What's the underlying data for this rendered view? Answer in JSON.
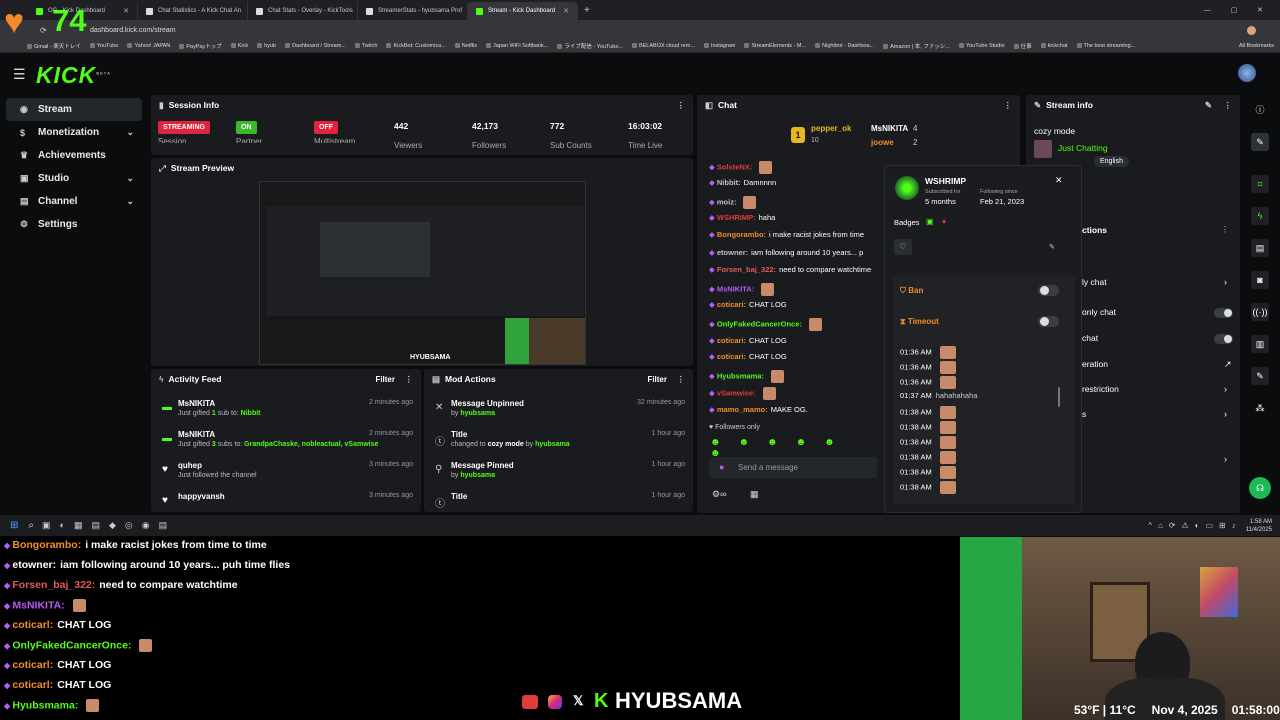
{
  "overlay": {
    "follower_count": "74"
  },
  "browser": {
    "tabs": [
      {
        "label": "OG - Kick Dashboard"
      },
      {
        "label": "Chat Statistics - A Kick Chat An"
      },
      {
        "label": "Chat Stats - Overlay - KickTools"
      },
      {
        "label": "StreamerStats - hyubsama Prof"
      },
      {
        "label": "Stream - Kick Dashboard"
      }
    ],
    "new_tab": "+",
    "url": "dashboard.kick.com/stream",
    "bookmarks": [
      "Gmail - 楽天トレイ",
      "YouTube",
      "Yahoo! JAPAN",
      "PayPayトップ",
      "Kick",
      "hyub",
      "Dashboard / Stream...",
      "Twitch",
      "KickBot: Customiza...",
      "Netflix",
      "Japan WiFi Softbank...",
      "ライブ配信 - YouTube...",
      "BELABOX cloud rem...",
      "Instagram",
      "StreamElements - M...",
      "Nightbot - Dashboa...",
      "Amazon | 本, ファッシ...",
      "YouTube Studio",
      "仕事",
      "kickchat",
      "The best streaming..."
    ],
    "all_bookmarks": "All Bookmarks"
  },
  "kick": {
    "logo": "KICK",
    "beta": "BETA"
  },
  "sidebar": {
    "items": [
      {
        "label": "Stream",
        "icon": "stream-icon"
      },
      {
        "label": "Monetization",
        "icon": "dollar-icon"
      },
      {
        "label": "Achievements",
        "icon": "trophy-icon"
      },
      {
        "label": "Studio",
        "icon": "studio-icon"
      },
      {
        "label": "Channel",
        "icon": "channel-icon"
      },
      {
        "label": "Settings",
        "icon": "gear-icon"
      }
    ]
  },
  "session": {
    "title": "Session Info",
    "streaming": "STREAMING",
    "session_label": "Session",
    "on": "ON",
    "partner_label": "Partner",
    "off": "OFF",
    "multistream_label": "Multistream",
    "viewers": "442",
    "viewers_label": "Viewers",
    "followers": "42,173",
    "followers_label": "Followers",
    "subs": "772",
    "subs_label": "Sub Counts",
    "time": "16:03:02",
    "time_label": "Time Live"
  },
  "preview": {
    "title": "Stream Preview",
    "watermark": "HYUBSAMA"
  },
  "activity": {
    "title": "Activity Feed",
    "filter": "Filter",
    "items": [
      {
        "user": "MsNIKITA",
        "pre": "Just gifted ",
        "count": "1",
        "mid": " sub to: ",
        "target": "Nibbit",
        "time": "2 minutes ago"
      },
      {
        "user": "MsNIKITA",
        "pre": "Just gifted ",
        "count": "3",
        "mid": " subs to: ",
        "target": "GrandpaChaske, nobleactual, vSamwise",
        "time": "2 minutes ago"
      },
      {
        "user": "quhep",
        "desc": "Just followed the channel",
        "time": "3 minutes ago"
      },
      {
        "user": "happyvansh",
        "desc": "",
        "time": "3 minutes ago"
      }
    ]
  },
  "mod": {
    "title": "Mod Actions",
    "filter": "Filter",
    "items": [
      {
        "title": "Message Unpinned",
        "desc": "by ",
        "user": "hyubsama",
        "time": "32 minutes ago"
      },
      {
        "title": "Title",
        "desc": "changed to ",
        "value": "cozy mode",
        "by": " by ",
        "user": "hyubsama",
        "time": "1 hour ago"
      },
      {
        "title": "Message Pinned",
        "desc": "by ",
        "user": "hyubsama",
        "time": "1 hour ago"
      },
      {
        "title": "Title",
        "desc": "",
        "time": "1 hour ago"
      }
    ]
  },
  "chat": {
    "title": "Chat",
    "leaders": [
      {
        "name": "pepper_ok",
        "value": "10"
      },
      {
        "name": "MsNIKITA",
        "value": "4"
      },
      {
        "name": "joowe",
        "value": "2"
      }
    ],
    "messages": [
      {
        "user": "SolsteNX:",
        "text": "",
        "color": "#e23b3b"
      },
      {
        "user": "Nibbit:",
        "text": "Damnnnn",
        "color": "#c0c0c0"
      },
      {
        "user": "moiz:",
        "text": "",
        "color": "#c0c0c0"
      },
      {
        "user": "WSHRIMP:",
        "text": "haha",
        "color": "#e23b3b"
      },
      {
        "user": "Bongorambo:",
        "text": "i make racist jokes from time",
        "color": "#f28c28"
      },
      {
        "user": "etowner:",
        "text": "iam following around 10 years... p",
        "color": "#c0c0c0"
      },
      {
        "user": "Forsen_baj_322:",
        "text": "need to compare watchtime",
        "color": "#e25a5a"
      },
      {
        "user": "MsNIKITA:",
        "text": "",
        "color": "#b45cf5"
      },
      {
        "user": "coticari:",
        "text": "CHAT LOG",
        "color": "#f28c28"
      },
      {
        "user": "OnlyFakedCancerOnce:",
        "text": "",
        "color": "#53fc18"
      },
      {
        "user": "coticari:",
        "text": "CHAT LOG",
        "color": "#f28c28"
      },
      {
        "user": "coticari:",
        "text": "CHAT LOG",
        "color": "#f28c28"
      },
      {
        "user": "Hyubsmama:",
        "text": "",
        "color": "#53fc18"
      },
      {
        "user": "vSamwise:",
        "text": "",
        "color": "#e23b3b"
      },
      {
        "user": "mamo_mamo:",
        "text": "MAKE OG.",
        "color": "#f28c28"
      }
    ],
    "followers_only": "Followers only",
    "placeholder": "Send a message"
  },
  "stream_info": {
    "title": "Stream info",
    "stream_title": "cozy mode",
    "category": "Just Chatting",
    "language": "English",
    "actions_frag": "ctions",
    "rows": [
      "ly chat",
      "only chat",
      "chat",
      "eration",
      "restriction",
      "s"
    ]
  },
  "popup": {
    "username": "WSHRIMP",
    "subscribed_label": "Subscribed for",
    "subscribed_value": "5 months",
    "following_label": "Following since",
    "following_value": "Feb 21, 2023",
    "badges_label": "Badges",
    "ban_label": "Ban",
    "timeout_label": "Timeout",
    "history": [
      {
        "time": "01:36 AM",
        "text": ""
      },
      {
        "time": "01:36 AM",
        "text": ""
      },
      {
        "time": "01:36 AM",
        "text": ""
      },
      {
        "time": "01:37 AM",
        "text": "hahahahaha"
      },
      {
        "time": "01:38 AM",
        "text": ""
      },
      {
        "time": "01:38 AM",
        "text": ""
      },
      {
        "time": "01:38 AM",
        "text": ""
      },
      {
        "time": "01:38 AM",
        "text": ""
      },
      {
        "time": "01:38 AM",
        "text": ""
      },
      {
        "time": "01:38 AM",
        "text": ""
      }
    ]
  },
  "taskbar": {
    "time": "1:58 AM",
    "date": "11/4/2025"
  },
  "overlay_chat": [
    {
      "user": "Bongorambo:",
      "text": "i make racist jokes from time to time",
      "color": "#f28c28"
    },
    {
      "user": "etowner:",
      "text": "iam following around 10 years... puh time flies",
      "color": "#ffffff"
    },
    {
      "user": "Forsen_baj_322:",
      "text": "need to compare watchtime",
      "color": "#e25a5a"
    },
    {
      "user": "MsNIKITA:",
      "text": "",
      "color": "#b45cf5"
    },
    {
      "user": "coticarl:",
      "text": "CHAT LOG",
      "color": "#f28c28"
    },
    {
      "user": "OnlyFakedCancerOnce:",
      "text": "",
      "color": "#53fc18"
    },
    {
      "user": "coticarl:",
      "text": "CHAT LOG",
      "color": "#f28c28"
    },
    {
      "user": "coticarl:",
      "text": "CHAT LOG",
      "color": "#f28c28"
    },
    {
      "user": "Hyubsmama:",
      "text": "",
      "color": "#53fc18"
    }
  ],
  "brand": "HYUBSAMA",
  "weather": {
    "temp": "53°F | 11°C",
    "date": "Nov 4, 2025",
    "time": "01:58:00"
  },
  "colors": {
    "kick_green": "#53fc18",
    "streaming_red": "#e0243b",
    "panel": "#191b1f"
  }
}
